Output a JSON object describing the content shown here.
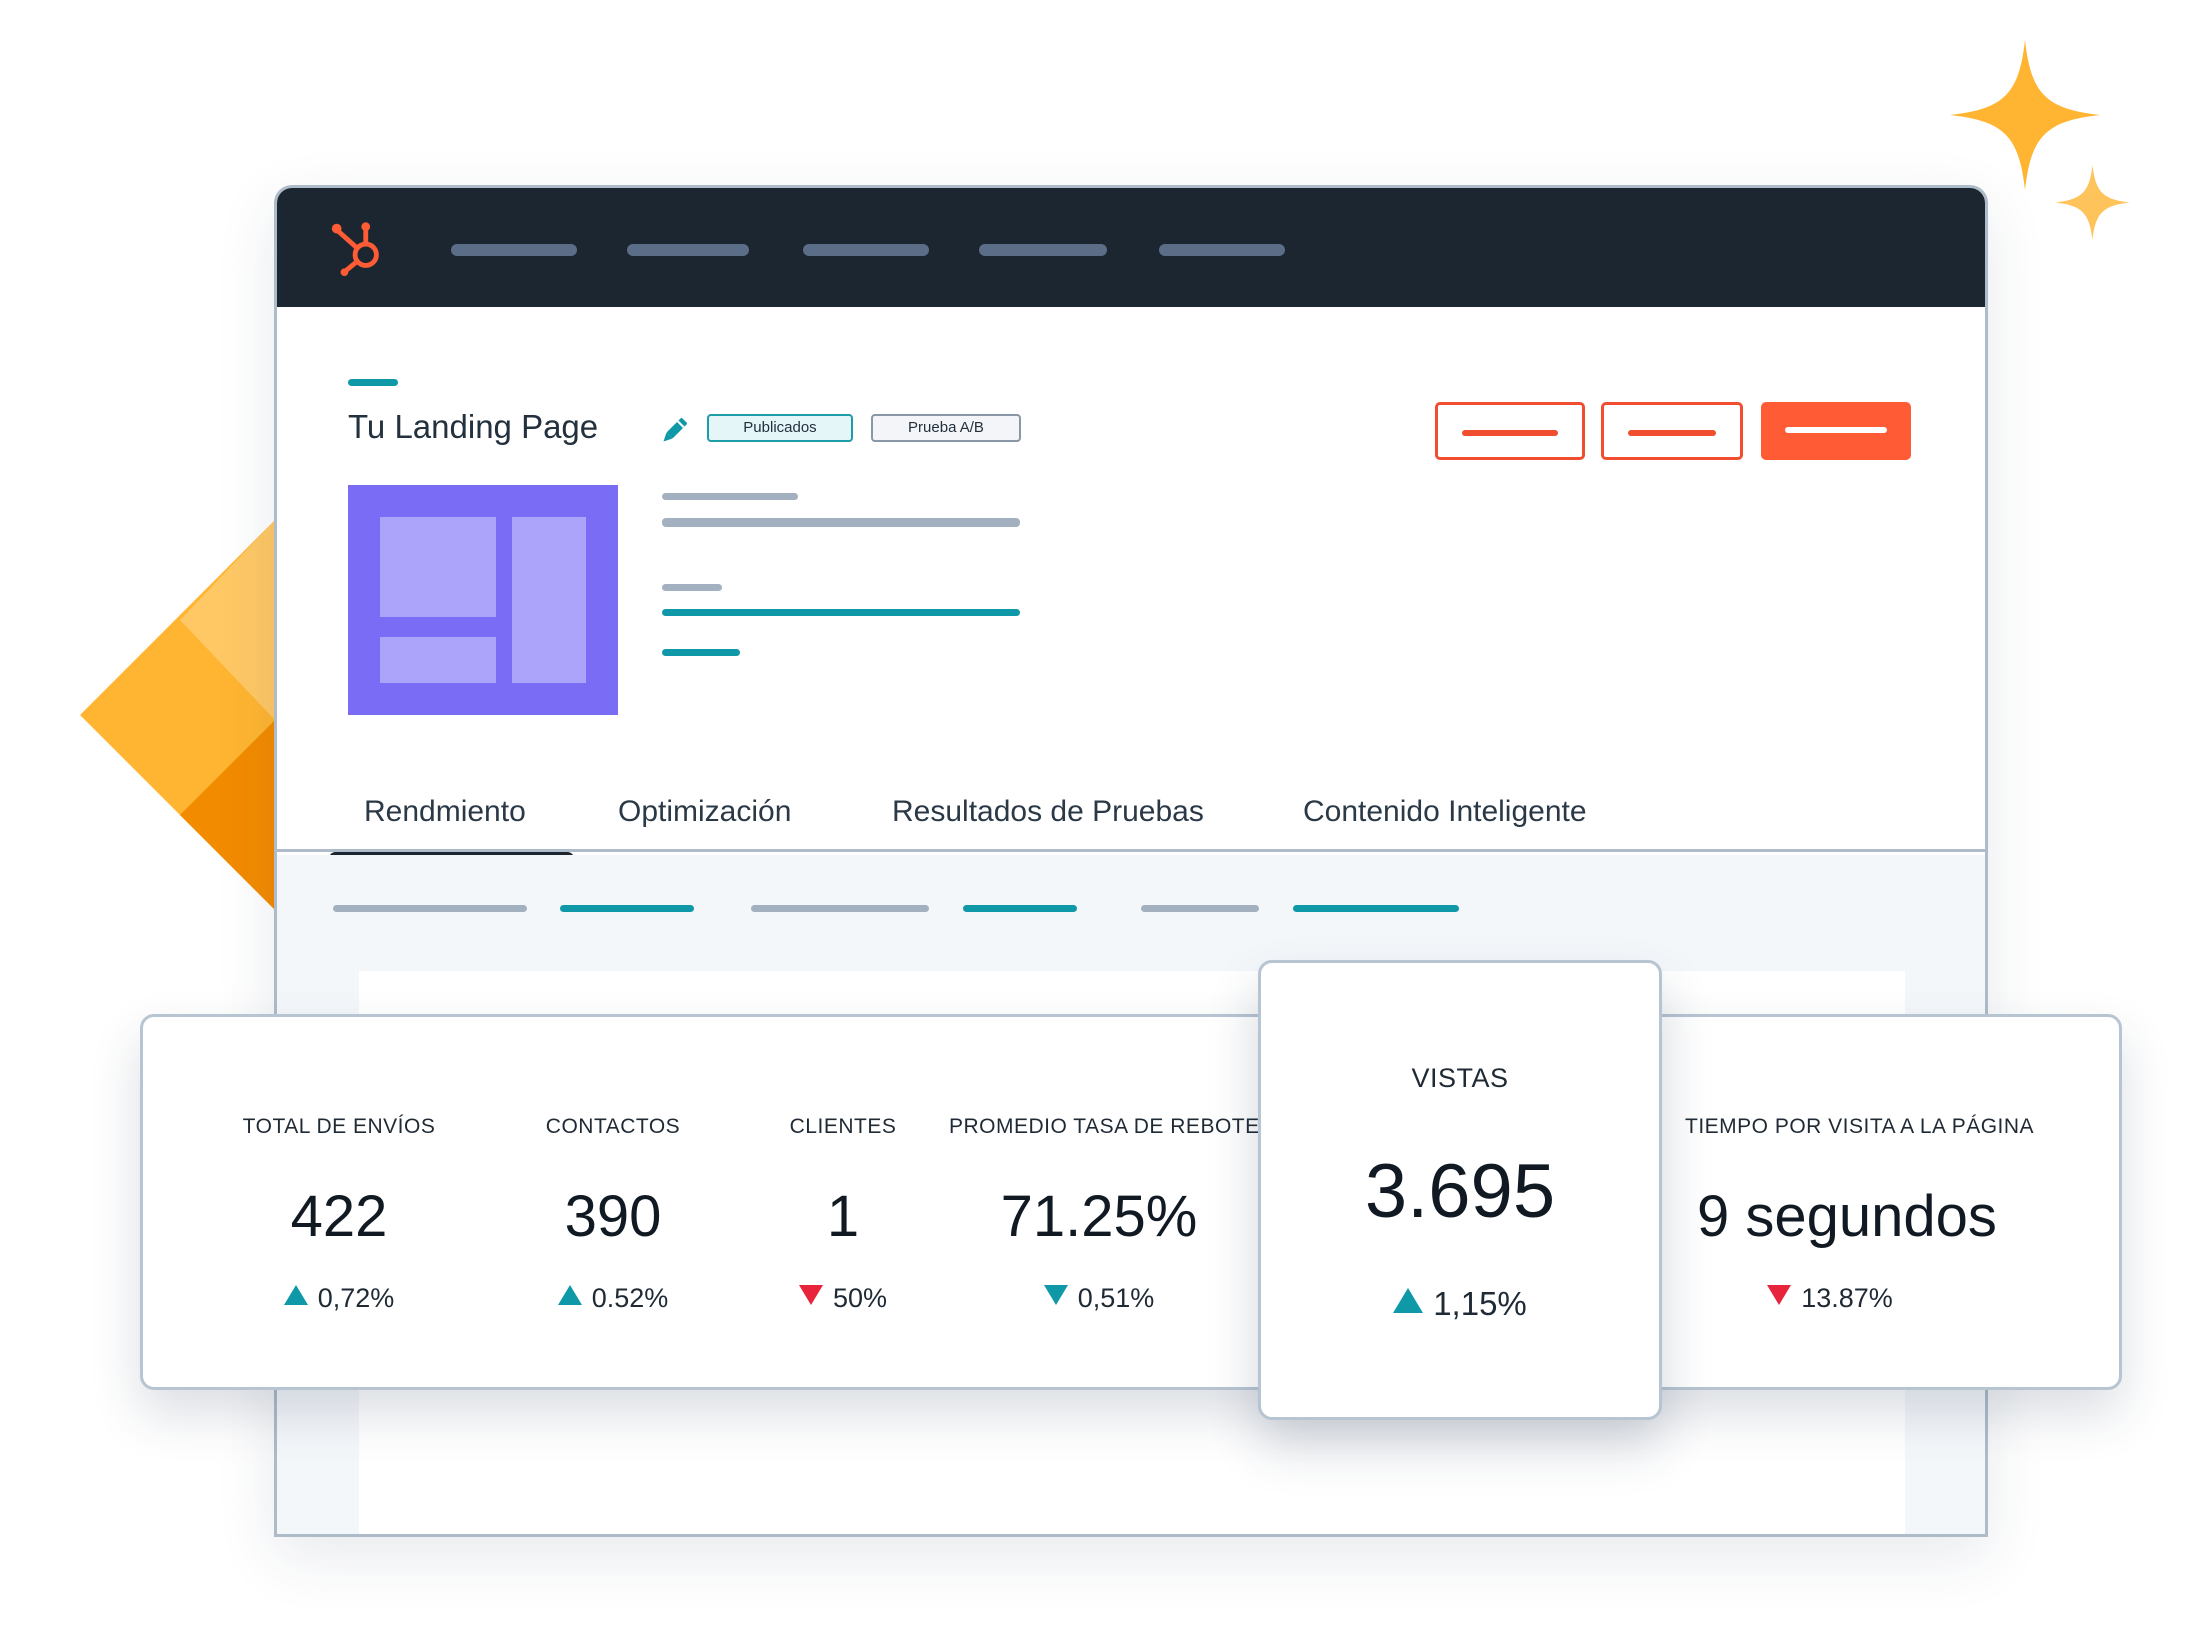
{
  "colors": {
    "topbar": "#1c2631",
    "accent_teal": "#0f99a8",
    "brand_orange": "#ff5c35",
    "thumbnail": "#7b6cf6",
    "sparkle": "#ffb531",
    "up": "#0f99a8",
    "down": "#e7243b"
  },
  "icons": {
    "logo": "hubspot-sprocket-icon",
    "edit": "pencil-icon",
    "sparkles": "sparkle-icon"
  },
  "header": {
    "title": "Tu Landing Page",
    "badges": [
      "Publicados",
      "Prueba A/B"
    ]
  },
  "tabs": [
    {
      "label": "Rendmiento",
      "active": true
    },
    {
      "label": "Optimización",
      "active": false
    },
    {
      "label": "Resultados de Pruebas",
      "active": false
    },
    {
      "label": "Contenido Inteligente",
      "active": false
    }
  ],
  "stats": [
    {
      "label": "TOTAL DE ENVÍOS",
      "value": "422",
      "change": "0,72%",
      "direction": "up"
    },
    {
      "label": "CONTACTOS",
      "value": "390",
      "change": "0.52%",
      "direction": "up"
    },
    {
      "label": "CLIENTES",
      "value": "1",
      "change": "50%",
      "direction": "down"
    },
    {
      "label": "PROMEDIO TASA DE REBOTE",
      "value": "71.25%",
      "change": "0,51%",
      "direction": "down"
    },
    {
      "label": "TIEMPO POR VISITA A LA PÁGINA",
      "value": "9 segundos",
      "change": "13.87%",
      "direction": "down"
    }
  ],
  "highlight": {
    "label": "VISTAS",
    "value": "3.695",
    "change": "1,15%",
    "direction": "up"
  }
}
